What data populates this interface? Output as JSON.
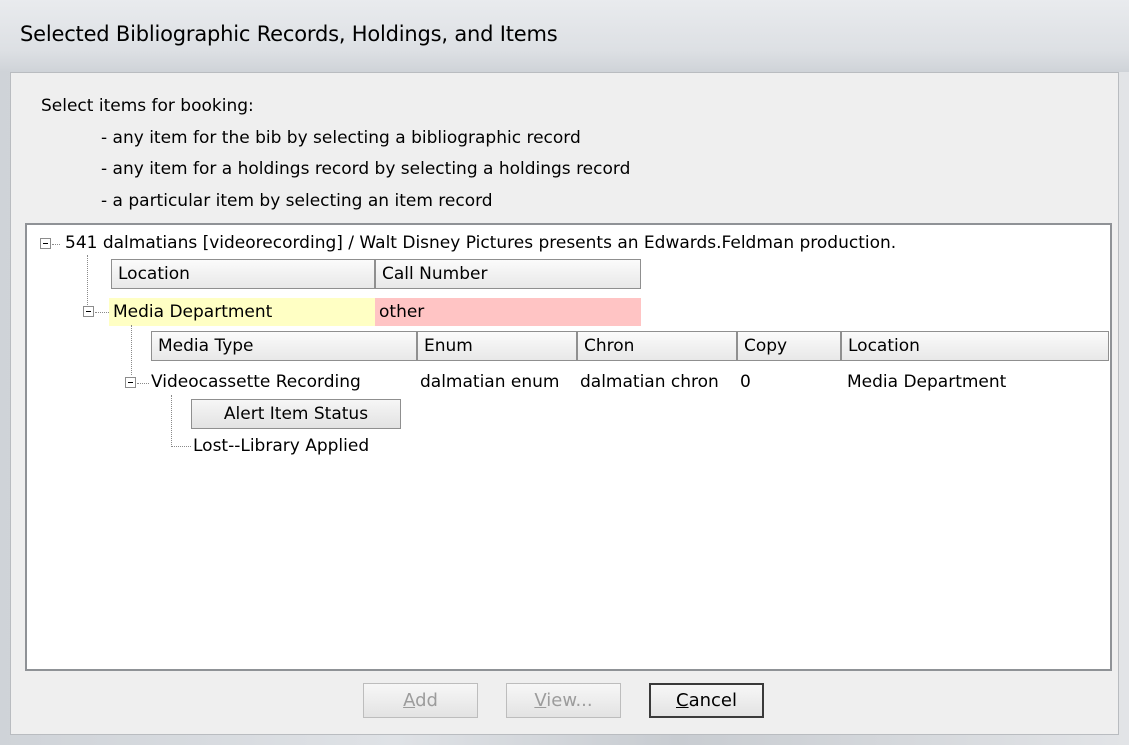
{
  "window": {
    "title": "Selected Bibliographic Records, Holdings, and Items"
  },
  "instructions": {
    "heading": "Select items for booking:",
    "bullets": [
      "- any item for the bib by selecting a bibliographic record",
      "- any item for a holdings record by selecting a holdings record",
      "- a particular item by selecting an item record"
    ]
  },
  "tree": {
    "bib_record": "541 dalmatians [videorecording] / Walt Disney Pictures presents an Edwards.Feldman production.",
    "holdings_headers": {
      "location": "Location",
      "call_number": "Call Number"
    },
    "holding": {
      "location": "Media Department",
      "call_number": "other"
    },
    "item_headers": {
      "media_type": "Media Type",
      "enum": "Enum",
      "chron": "Chron",
      "copy": "Copy",
      "location": "Location"
    },
    "item": {
      "media_type": "Videocassette Recording",
      "enum": "dalmatian enum",
      "chron": "dalmatian chron",
      "copy": "0",
      "location": "Media Department"
    },
    "alert_header": "Alert Item Status",
    "alert_value": "Lost--Library Applied"
  },
  "buttons": {
    "add_prefix": "",
    "add_mnemonic": "A",
    "add_rest": "dd",
    "view_prefix": "",
    "view_mnemonic": "V",
    "view_rest": "iew...",
    "cancel_prefix": "",
    "cancel_mnemonic": "C",
    "cancel_rest": "ancel"
  }
}
